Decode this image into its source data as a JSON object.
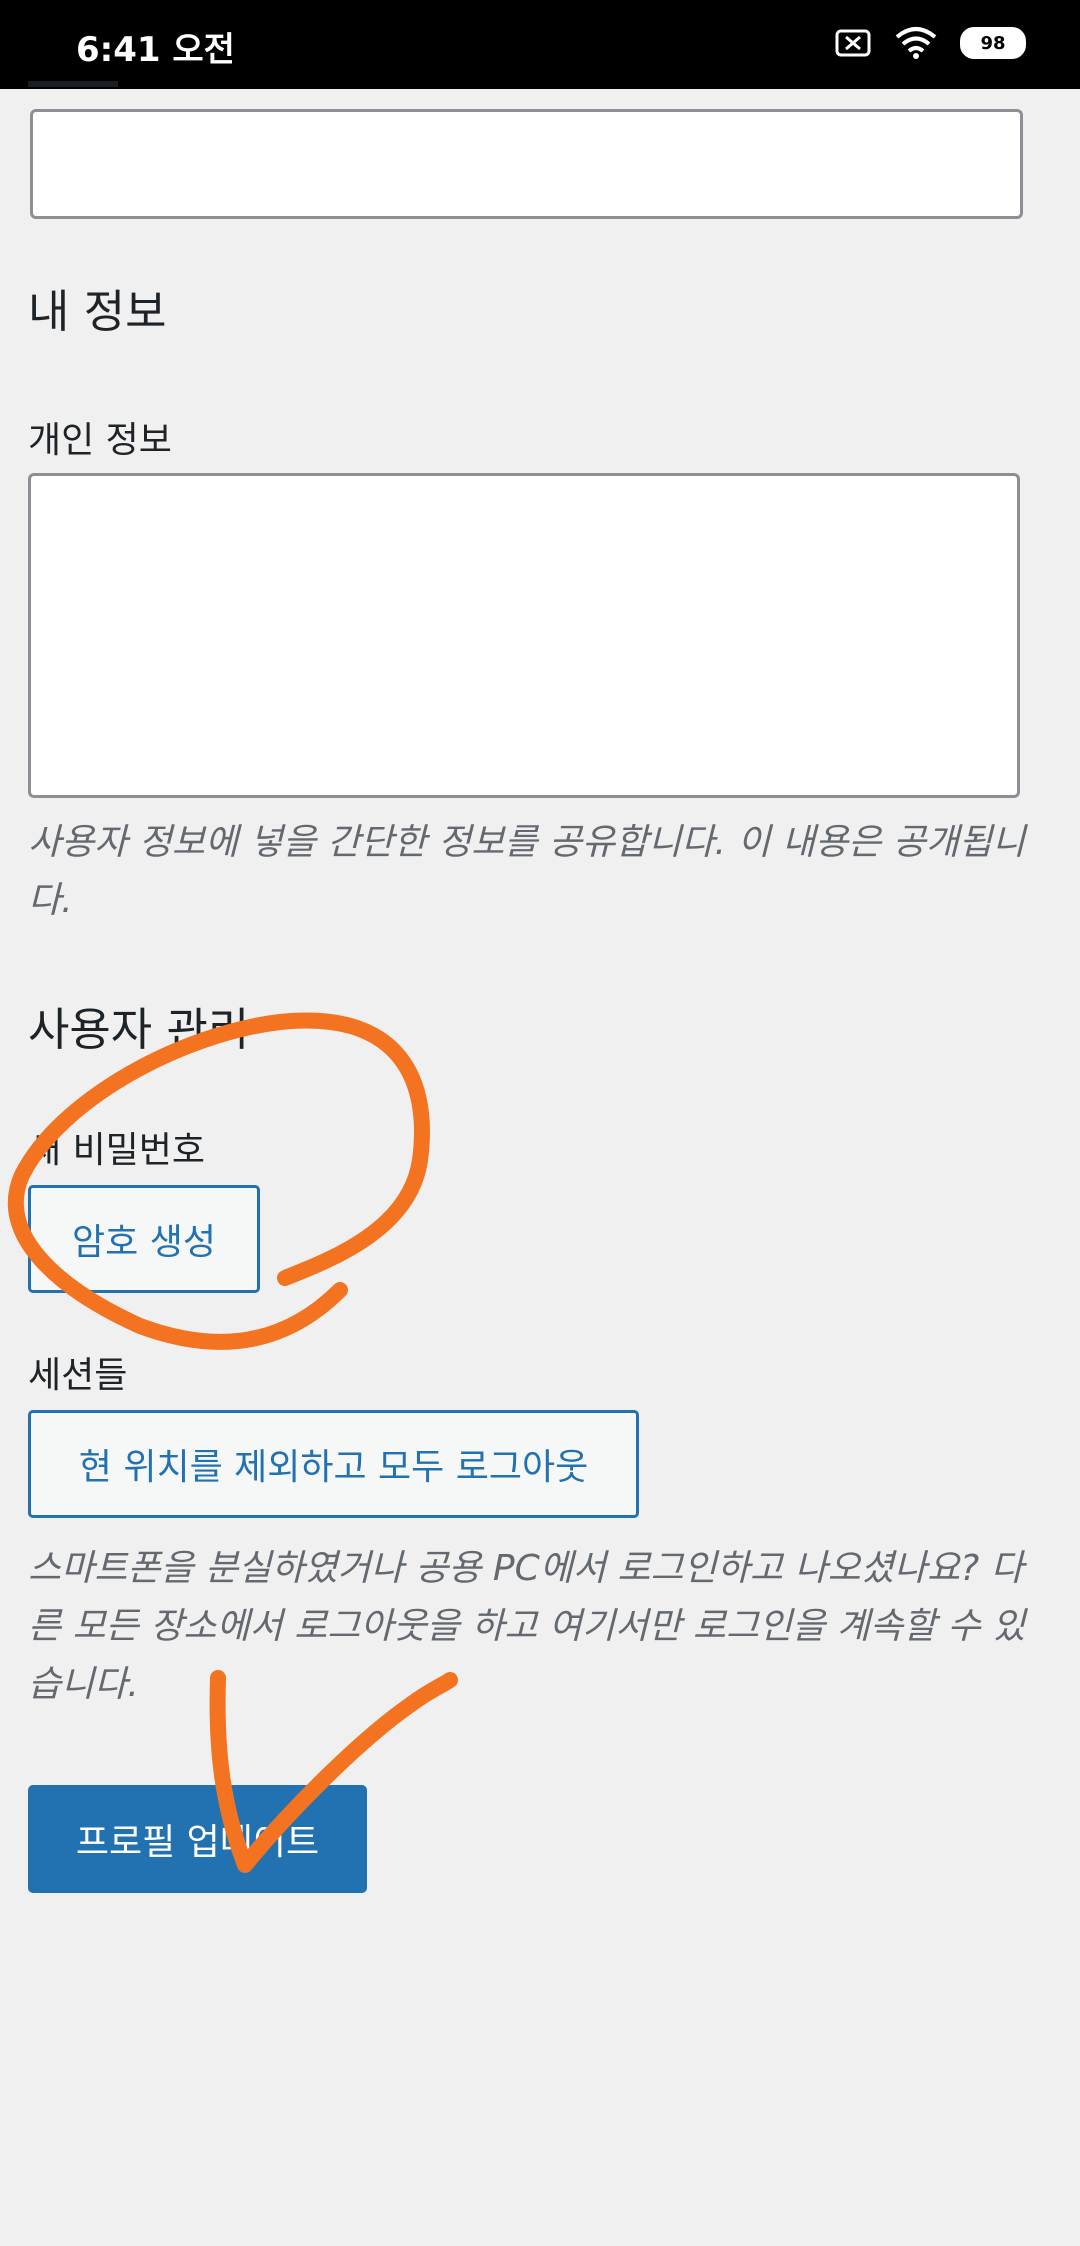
{
  "status_bar": {
    "time": "6:41 오전",
    "battery": "98",
    "icons": [
      "notification-muted-icon",
      "wifi-icon",
      "battery-icon"
    ]
  },
  "sections": {
    "top_field_value": "",
    "about_heading": "내 정보",
    "bio_label": "개인 정보",
    "bio_value": "",
    "bio_description": "사용자 정보에 넣을 간단한 정보를 공유합니다. 이 내용은 공개됩니다.",
    "account_heading": "사용자 관리",
    "new_password_label": "새 비밀번호",
    "generate_password_button": "암호 생성",
    "sessions_label": "세션들",
    "logout_everywhere_button": "현 위치를 제외하고 모두 로그아웃",
    "sessions_description": "스마트폰을 분실하였거나 공용 PC에서 로그인하고 나오셨나요? 다른 모든 장소에서 로그아웃을 하고 여기서만 로그인을 계속할 수 있습니다.",
    "update_profile_button": "프로필 업데이트"
  },
  "colors": {
    "annotation": "#f47321",
    "primary": "#2271b1",
    "background": "#f0f0f1"
  }
}
